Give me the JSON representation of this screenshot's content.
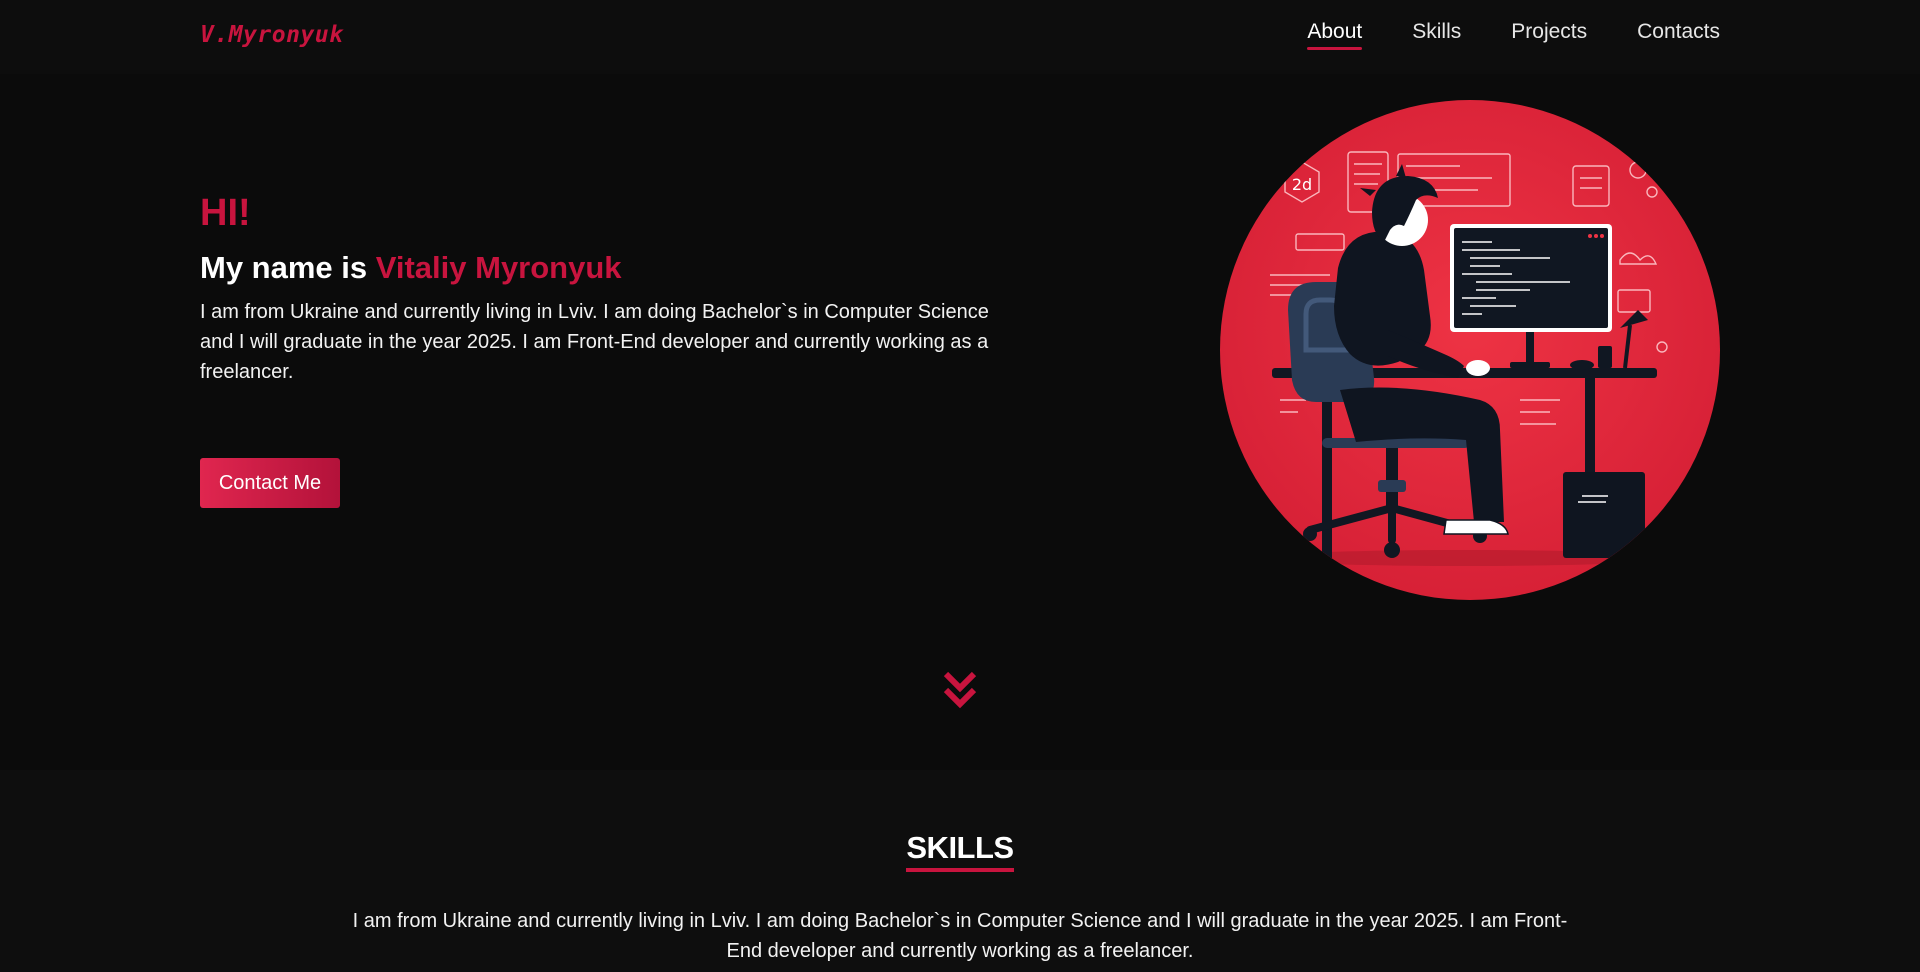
{
  "brand": {
    "logo_text": "V.Myronyuk"
  },
  "nav": {
    "items": [
      {
        "label": "About",
        "active": true
      },
      {
        "label": "Skills",
        "active": false
      },
      {
        "label": "Projects",
        "active": false
      },
      {
        "label": "Contacts",
        "active": false
      }
    ]
  },
  "hero": {
    "greeting": "HI!",
    "name_prefix": "My name is ",
    "name": "Vitaliy Myronyuk",
    "description": "I am from Ukraine and currently living in Lviv. I am doing Bachelor`s in Computer Science and I will graduate in the year 2025. I am Front-End developer and currently working as a freelancer.",
    "cta_label": "Contact Me",
    "illustration_label": "2d"
  },
  "skills": {
    "title": "SKILLS",
    "description": "I am from Ukraine and currently living in Lviv. I am doing Bachelor`s in Computer Science and I will graduate in the year 2025. I am Front-End developer and currently working as a freelancer."
  },
  "icons": {
    "scroll": "double-chevron-down-icon"
  },
  "colors": {
    "accent": "#c8143e",
    "background": "#0b0b0b",
    "illustration_red": "#e0283c"
  }
}
